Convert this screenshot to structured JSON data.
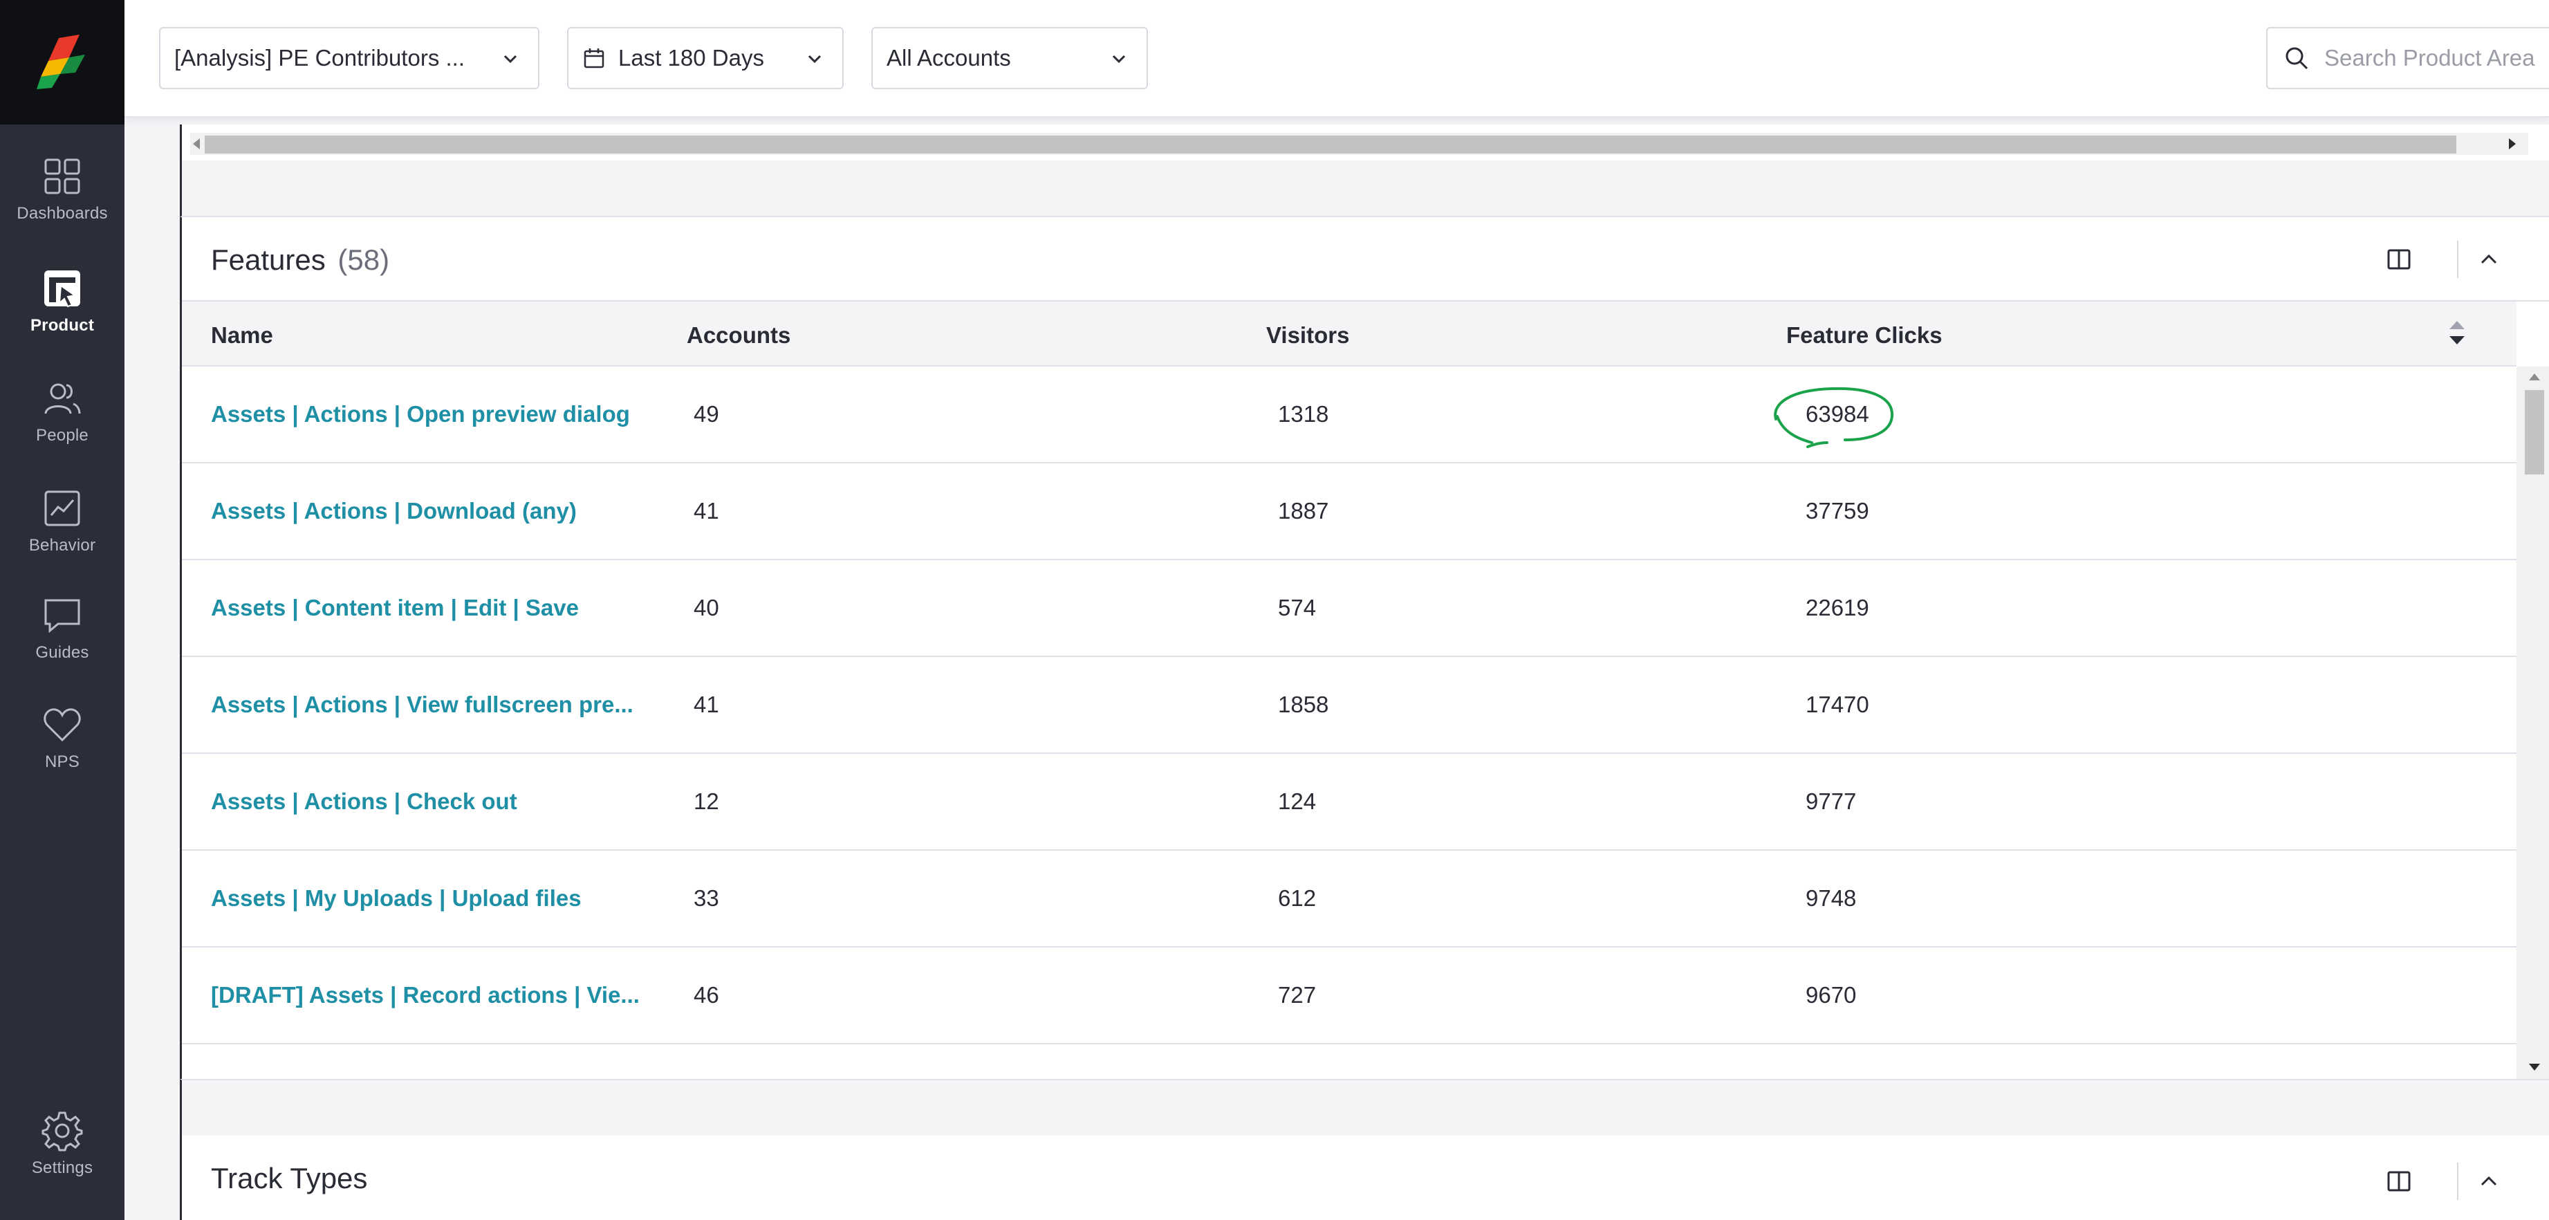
{
  "sidebar": {
    "items": [
      {
        "label": "Dashboards",
        "icon": "grid-icon"
      },
      {
        "label": "Product",
        "icon": "product-icon",
        "active": true
      },
      {
        "label": "People",
        "icon": "people-icon"
      },
      {
        "label": "Behavior",
        "icon": "behavior-icon"
      },
      {
        "label": "Guides",
        "icon": "guides-icon"
      },
      {
        "label": "NPS",
        "icon": "heart-icon"
      }
    ],
    "settings_label": "Settings"
  },
  "header": {
    "segment_select": "[Analysis] PE Contributors ...",
    "date_select": "Last 180 Days",
    "accounts_select": "All Accounts",
    "search_placeholder": "Search Product Area"
  },
  "features_panel": {
    "title": "Features",
    "count": "(58)",
    "columns": {
      "name": "Name",
      "accounts": "Accounts",
      "visitors": "Visitors",
      "feature_clicks": "Feature Clicks"
    },
    "rows": [
      {
        "name": "Assets | Actions | Open preview dialog",
        "accounts": "49",
        "visitors": "1318",
        "feature_clicks": "63984"
      },
      {
        "name": "Assets | Actions | Download (any)",
        "accounts": "41",
        "visitors": "1887",
        "feature_clicks": "37759"
      },
      {
        "name": "Assets | Content item | Edit | Save",
        "accounts": "40",
        "visitors": "574",
        "feature_clicks": "22619"
      },
      {
        "name": "Assets | Actions | View fullscreen pre...",
        "accounts": "41",
        "visitors": "1858",
        "feature_clicks": "17470"
      },
      {
        "name": "Assets | Actions | Check out",
        "accounts": "12",
        "visitors": "124",
        "feature_clicks": "9777"
      },
      {
        "name": "Assets | My Uploads | Upload files",
        "accounts": "33",
        "visitors": "612",
        "feature_clicks": "9748"
      },
      {
        "name": "[DRAFT] Assets | Record actions | Vie...",
        "accounts": "46",
        "visitors": "727",
        "feature_clicks": "9670"
      }
    ]
  },
  "track_types_panel": {
    "title": "Track Types"
  },
  "colors": {
    "sidebar_bg": "#2b2e38",
    "link": "#1f8fa6",
    "annotation": "#1aa34a"
  }
}
